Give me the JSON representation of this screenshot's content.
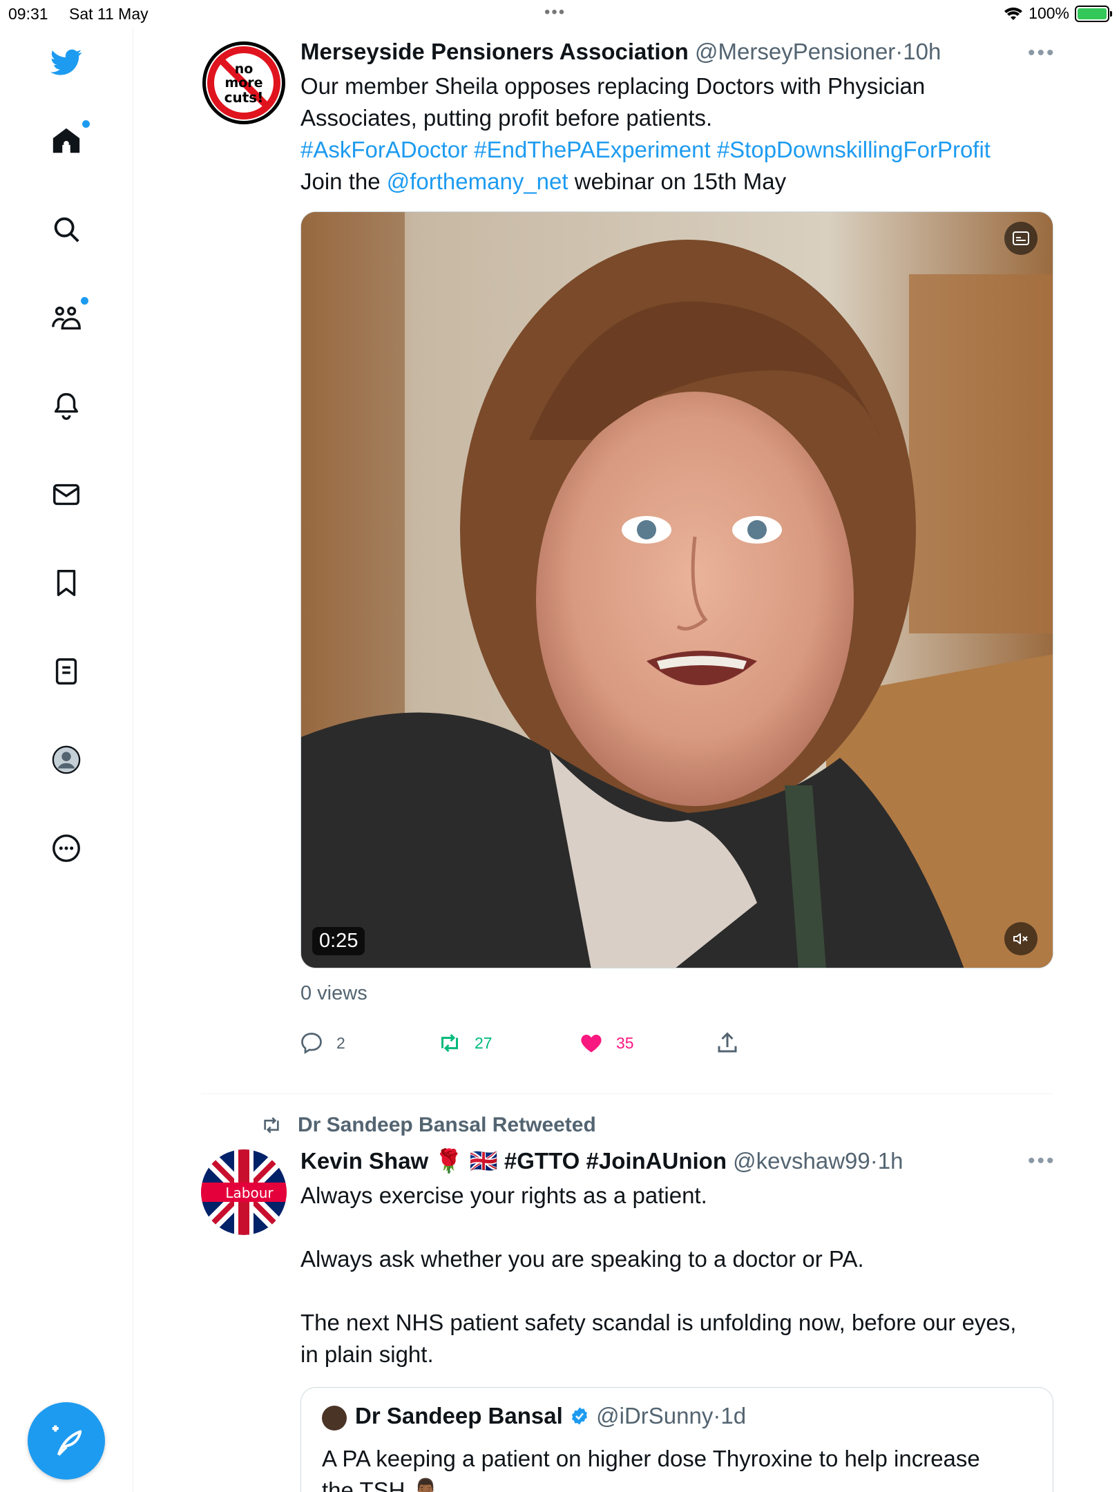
{
  "status_bar": {
    "time": "09:31",
    "date": "Sat 11 May",
    "battery": "100%"
  },
  "nav": [
    "twitter-logo",
    "home-icon",
    "search-icon",
    "communities-icon",
    "notifications-icon",
    "messages-icon",
    "bookmarks-icon",
    "lists-icon",
    "profile-icon",
    "more-icon"
  ],
  "tweet1": {
    "name": "Merseyside Pensioners Association",
    "handle": "@MerseyPensioner",
    "sep": "·",
    "time": "10h",
    "avatar_text_1": "no",
    "avatar_text_2": "more",
    "avatar_text_3": "cuts!",
    "text_line1": "Our member Sheila opposes replacing Doctors with Physician",
    "text_line2": "Associates, putting profit before patients.",
    "hashtags": "#AskForADoctor #EndThePAExperiment #StopDownskillingForProfit",
    "join_pre": "Join the ",
    "mention": "@forthemany_net",
    "join_post": " webinar on 15th May",
    "video_duration": "0:25",
    "views": "0 views",
    "replies": "2",
    "retweets": "27",
    "likes": "35"
  },
  "tweet2": {
    "retweeted_by": "Dr Sandeep Bansal Retweeted",
    "name": "Kevin Shaw 🌹 🇬🇧 #GTTO #JoinAUnion",
    "handle": "@kevshaw99",
    "sep": "·",
    "time": "1h",
    "avatar_text": "Labour",
    "line1": "Always exercise your rights as a patient.",
    "line2": "Always ask whether you are speaking to a doctor or PA.",
    "line3": "The next NHS patient safety scandal is unfolding now, before our eyes,",
    "line4": "in plain sight."
  },
  "quote": {
    "name": "Dr Sandeep Bansal",
    "handle": "@iDrSunny",
    "sep": "·",
    "time": "1d",
    "line1": "A PA keeping a patient on higher dose Thyroxine to help increase",
    "line2": "the TSH 🤦🏾‍♂️"
  },
  "colors": {
    "accent": "#1d9bf0",
    "retweet": "#00ba7c",
    "like": "#f91880"
  }
}
